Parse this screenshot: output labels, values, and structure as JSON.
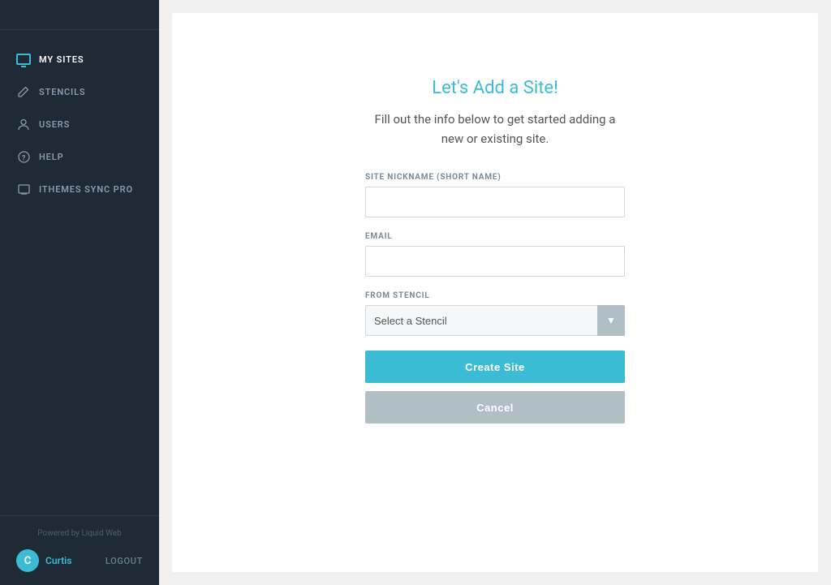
{
  "sidebar": {
    "nav_items": [
      {
        "id": "my-sites",
        "label": "MY SITES",
        "active": true,
        "icon": "monitor"
      },
      {
        "id": "stencils",
        "label": "STENCILS",
        "active": false,
        "icon": "pencil"
      },
      {
        "id": "users",
        "label": "USERS",
        "active": false,
        "icon": "user"
      },
      {
        "id": "help",
        "label": "HELP",
        "active": false,
        "icon": "help"
      },
      {
        "id": "ithemes-sync-pro",
        "label": "ITHEMES SYNC PRO",
        "active": false,
        "icon": "sync"
      }
    ],
    "footer": {
      "powered_by": "Powered by Liquid Web",
      "user_name": "Curtis",
      "logout_label": "LOGOUT",
      "user_initial": "C"
    }
  },
  "main": {
    "title": "Let's Add a Site!",
    "subtitle": "Fill out the info below to get started adding a new or existing site.",
    "form": {
      "nickname_label": "SITE NICKNAME (SHORT NAME)",
      "nickname_placeholder": "",
      "email_label": "EMAIL",
      "email_placeholder": "",
      "stencil_label": "FROM STENCIL",
      "stencil_placeholder": "Select a Stencil",
      "create_button": "Create Site",
      "cancel_button": "Cancel"
    }
  }
}
